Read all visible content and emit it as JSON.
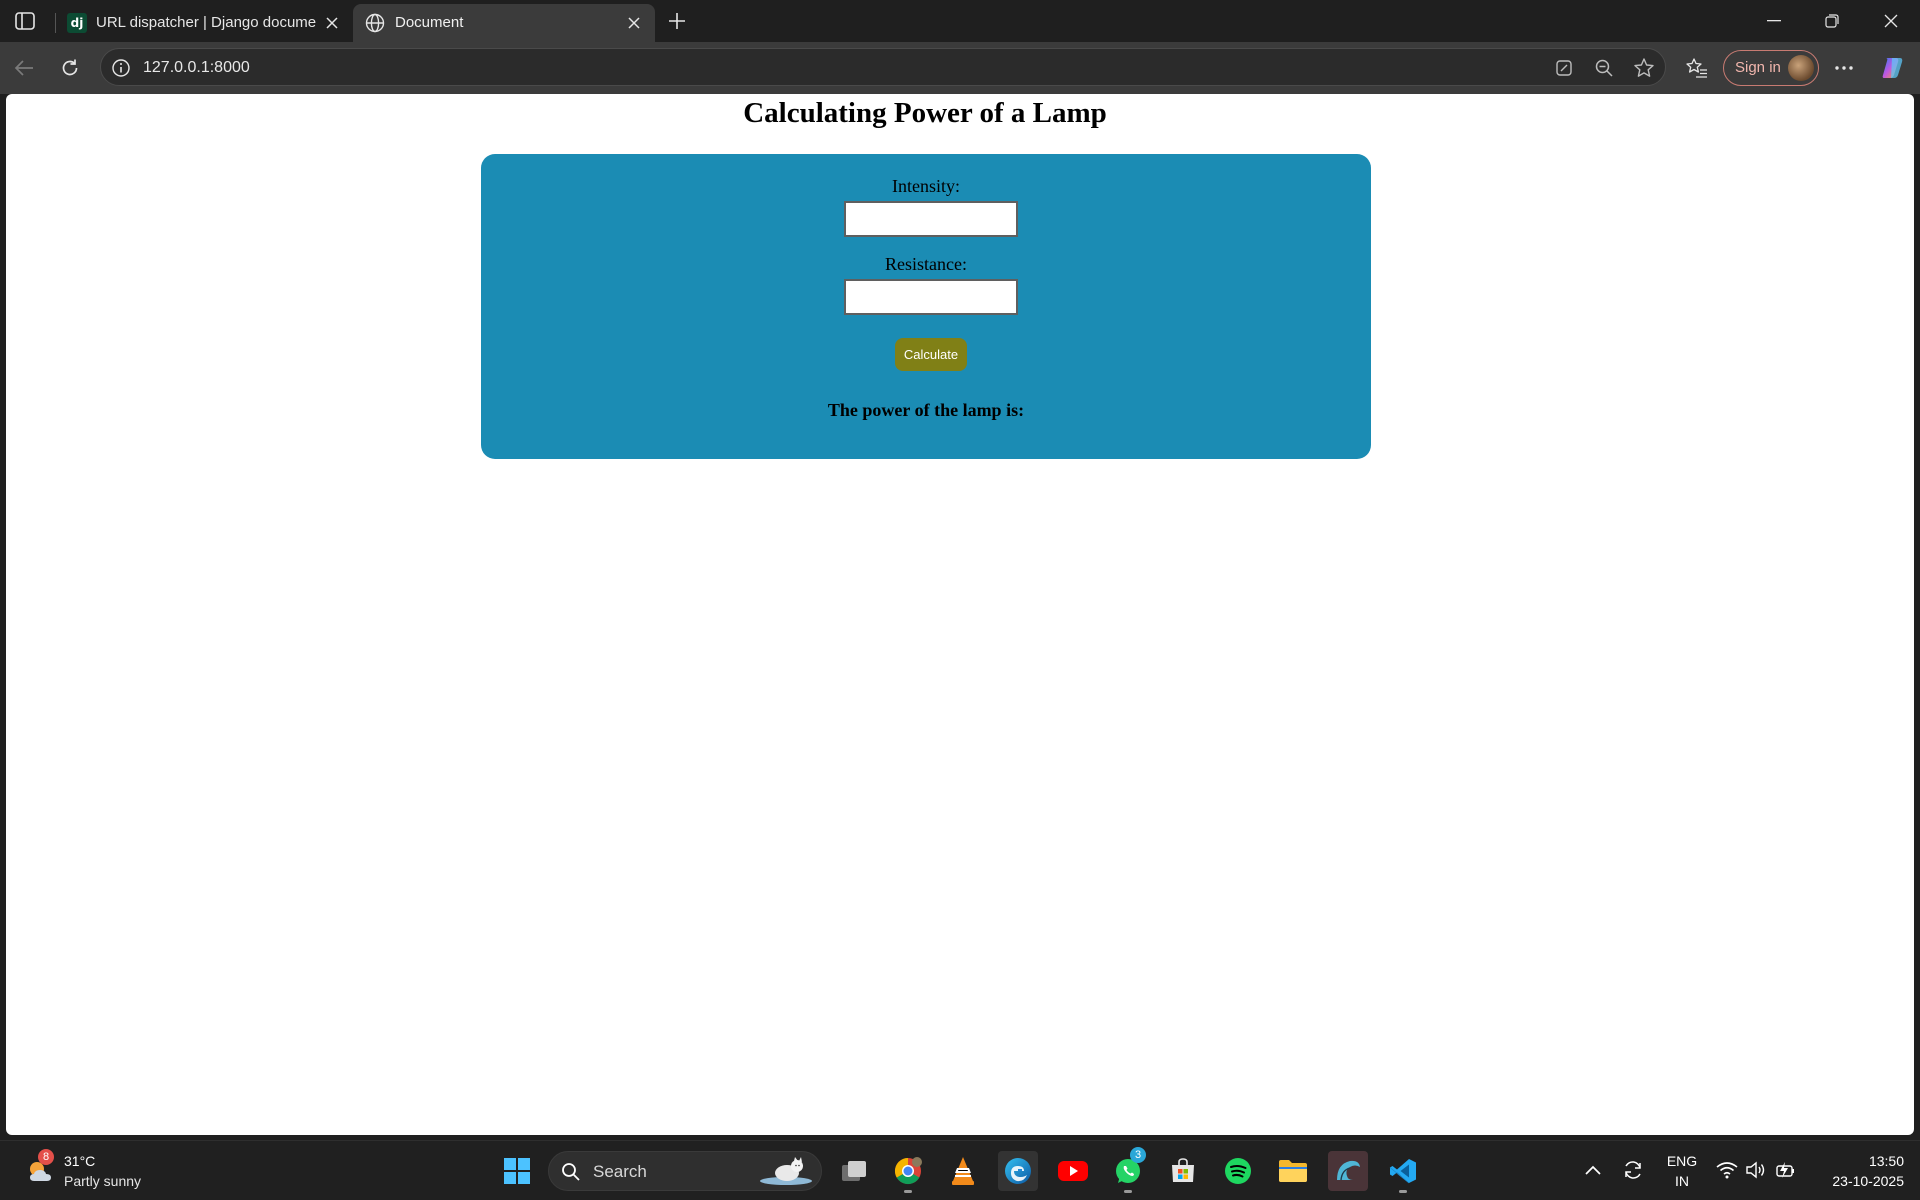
{
  "browser": {
    "tabs": [
      {
        "title": "URL dispatcher | Django documer",
        "icon": "django-icon",
        "active": false
      },
      {
        "title": "Document",
        "icon": "globe-icon",
        "active": true
      }
    ],
    "url": "127.0.0.1:8000",
    "sign_in_label": "Sign in"
  },
  "page": {
    "title": "Calculating Power of a Lamp",
    "intensity_label": "Intensity:",
    "intensity_value": "",
    "resistance_label": "Resistance:",
    "resistance_value": "",
    "calculate_label": "Calculate",
    "result_label": "The power of the lamp is:"
  },
  "colors": {
    "card": "#1b8cb4",
    "button": "#808016"
  },
  "taskbar": {
    "weather_badge": "8",
    "temperature": "31°C",
    "condition": "Partly sunny",
    "search_label": "Search",
    "whatsapp_badge": "3",
    "language_line1": "ENG",
    "language_line2": "IN",
    "time": "13:50",
    "date": "23-10-2025"
  }
}
